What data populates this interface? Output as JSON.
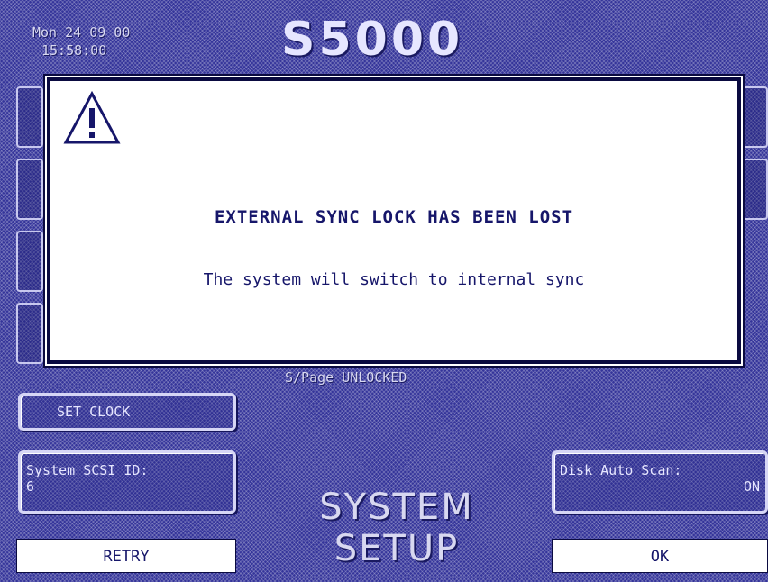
{
  "header": {
    "date": "Mon 24 09 00",
    "time": "15:58:00",
    "logo": "S5000"
  },
  "background_buttons": {
    "set_clock": "SET CLOCK",
    "scsi_label": "System SCSI ID:",
    "scsi_value": "6",
    "disk_auto_label": "Disk Auto Scan:",
    "disk_auto_value": "ON",
    "space_note": "S/Page UNLOCKED"
  },
  "screen_title": {
    "line1": "SYSTEM",
    "line2": "SETUP"
  },
  "softkeys": {
    "left": "RETRY",
    "right": "OK"
  },
  "dialog": {
    "icon": "warning-icon",
    "heading": "EXTERNAL SYNC LOCK HAS BEEN LOST",
    "message": "The system will switch to internal sync"
  },
  "colors": {
    "background": "#35359a",
    "dialog_text": "#16166a",
    "dialog_bg": "#ffffff"
  }
}
